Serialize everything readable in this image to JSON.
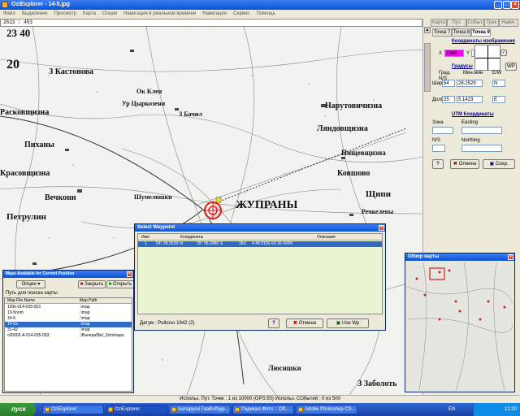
{
  "window": {
    "title": "OziExplorer - 14-5.jpg"
  },
  "menu": [
    "Файл",
    "Выделение",
    "Просмотр",
    "Карта",
    "Опции",
    "Навигация в реальном времени",
    "Навигация",
    "Сервис",
    "Помощь"
  ],
  "coord_readout": "2513 : 453",
  "map_labels": {
    "grid_top": "23 40",
    "grid_left": "20",
    "kastonova": "З Кастонова",
    "ok_klen": "Ок Клен",
    "tsyrkozeni": "Ур Цыркозени",
    "bachil": "З Бачил",
    "narutovichizna": "Нарутовичизна",
    "raskovschizna": "Расковщизна",
    "lyadovschizna": "Ляндовщизна",
    "pikhany": "Пиханы",
    "pishchevschizna": "Пищевщизна",
    "kovshovo": "Ковшово",
    "krasovschizna": "Красовщизна",
    "vechkoni": "Вечкони",
    "shumelishki": "Шумелишки",
    "zhuprany": "ЖУПРАНЫ",
    "shchipi": "Щипи",
    "petrulin": "Петрулин",
    "rechkelivy": "Речкелевы",
    "zabolot": "З Заболоть",
    "lyoshnishki": "Люсишки"
  },
  "right_panel": {
    "tabs": [
      "Точка 7",
      "Точка 8",
      "Точка 9"
    ],
    "top_tabs": [
      "Карта",
      "Пут. точ.",
      "Событ.",
      "Трек",
      "Навиг."
    ],
    "image_coords_title": "Координаты изображения",
    "x_label": "X",
    "x_value": "2385",
    "y_label": "Y",
    "wp_button": "WP",
    "degrees_title": "Градусы",
    "col_deg": "Град.",
    "col_min": "Мин.мин",
    "col_ne": "N/S",
    "col_ew": "E/W",
    "lat_label": "Шир",
    "lat_deg": "54",
    "lat_min": "28.2529",
    "lat_hemi": "N",
    "lon_label": "Долг",
    "lon_deg": "25",
    "lon_min": "5.1423",
    "lon_hemi": "E",
    "utm_title": "UTM Координаты",
    "zone_label": "Зона",
    "easting_label": "Easting",
    "ns_label": "N/S",
    "northing_label": "Northing",
    "help_button": "?",
    "cancel_button": "Отмена",
    "save_button": "Сохр."
  },
  "maps_window": {
    "title": "Maps Available for Current Position",
    "options_button": "Опции",
    "close_button": "Закрыть",
    "open_button": "Открыть",
    "path_label": "Путь для поиска карты",
    "headers": [
      "Map File Name",
      "Map Path"
    ],
    "rows": [
      {
        "name": "100k-014-035-053",
        "path": ".\\map"
      },
      {
        "name": "13-5nnm",
        "path": ".\\map"
      },
      {
        "name": "14-5",
        "path": ".\\map"
      },
      {
        "name": "14-5a",
        "path": ".\\map"
      },
      {
        "name": "31-42",
        "path": ".\\map"
      },
      {
        "name": "c00002-A-014-035-053",
        "path": ".\\Валера\\Bel_1km\\maps"
      }
    ],
    "selected_index": 3
  },
  "waypoint_dialog": {
    "title": "Select Waypoint",
    "headers": [
      "Имя",
      "Координаты",
      "",
      "",
      "Описание"
    ],
    "row": {
      "name": "1",
      "lat": "54° 28.2529' N",
      "lon": "25° 05.2580' E",
      "zone": "35U",
      "utm": "4 48 915E  60 36 420N",
      "desc": ""
    },
    "datum": "Датум : Pulkovo 1942 (2)",
    "help_button": "?",
    "cancel_button": "Отмена",
    "usewp_button": "Use Wp"
  },
  "overview": {
    "title": "Обзор карты"
  },
  "status_bar": "Использ. Пут. Точек : 1 из 10000  (GPS:50)  Использ. СОбытий : 0 из 500",
  "taskbar": {
    "start": "пуск",
    "tasks": [
      "OziExplorer",
      "OziExplorer",
      "Беларускі ГеаВэбзур...",
      "Радикал-Фото :: Об...",
      "Adobe Photoshop CS..."
    ],
    "lang": "EN",
    "clock": "12:20"
  },
  "colors": {
    "accent": "#0a53d8",
    "x_field": "#ff00ff",
    "selected_row": "#316ac5",
    "dialog_list": "#e8f5d0",
    "marker": "#e02020"
  }
}
